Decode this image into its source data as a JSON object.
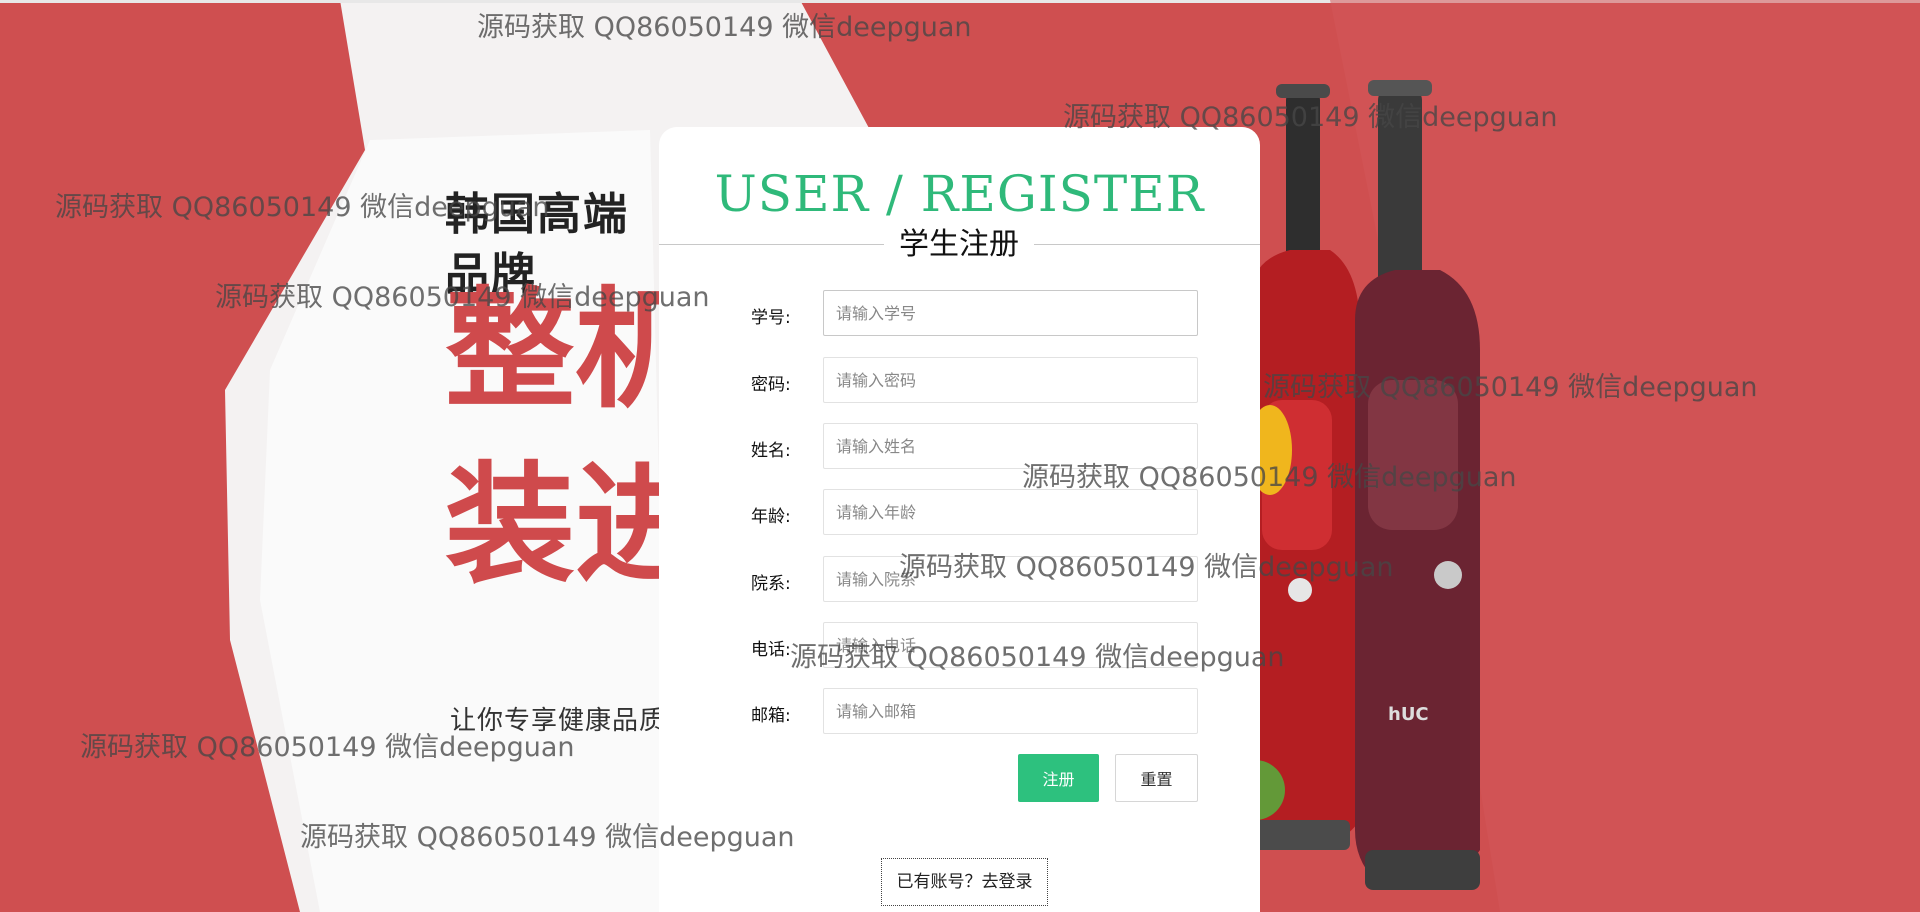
{
  "promo": {
    "brand": "韩国高端品牌",
    "big_line1": "整机原",
    "big_line2": "装进口",
    "slogan": "让你专享健康品质生活"
  },
  "form": {
    "title": "USER / REGISTER",
    "subtitle": "学生注册",
    "fields": [
      {
        "label": "学号:",
        "placeholder": "请输入学号"
      },
      {
        "label": "密码:",
        "placeholder": "请输入密码"
      },
      {
        "label": "姓名:",
        "placeholder": "请输入姓名"
      },
      {
        "label": "年龄:",
        "placeholder": "请输入年龄"
      },
      {
        "label": "院系:",
        "placeholder": "请输入院系"
      },
      {
        "label": "电话:",
        "placeholder": "请输入电话"
      },
      {
        "label": "邮箱:",
        "placeholder": "请输入邮箱"
      }
    ],
    "submit_label": "注册",
    "reset_label": "重置",
    "login_link": "已有账号？去登录"
  },
  "watermark": "源码获取 QQ86050149 微信deepguan",
  "colors": {
    "background_red": "#cf4f50",
    "accent_green": "#2fb97a",
    "button_green": "#2dc17e"
  }
}
